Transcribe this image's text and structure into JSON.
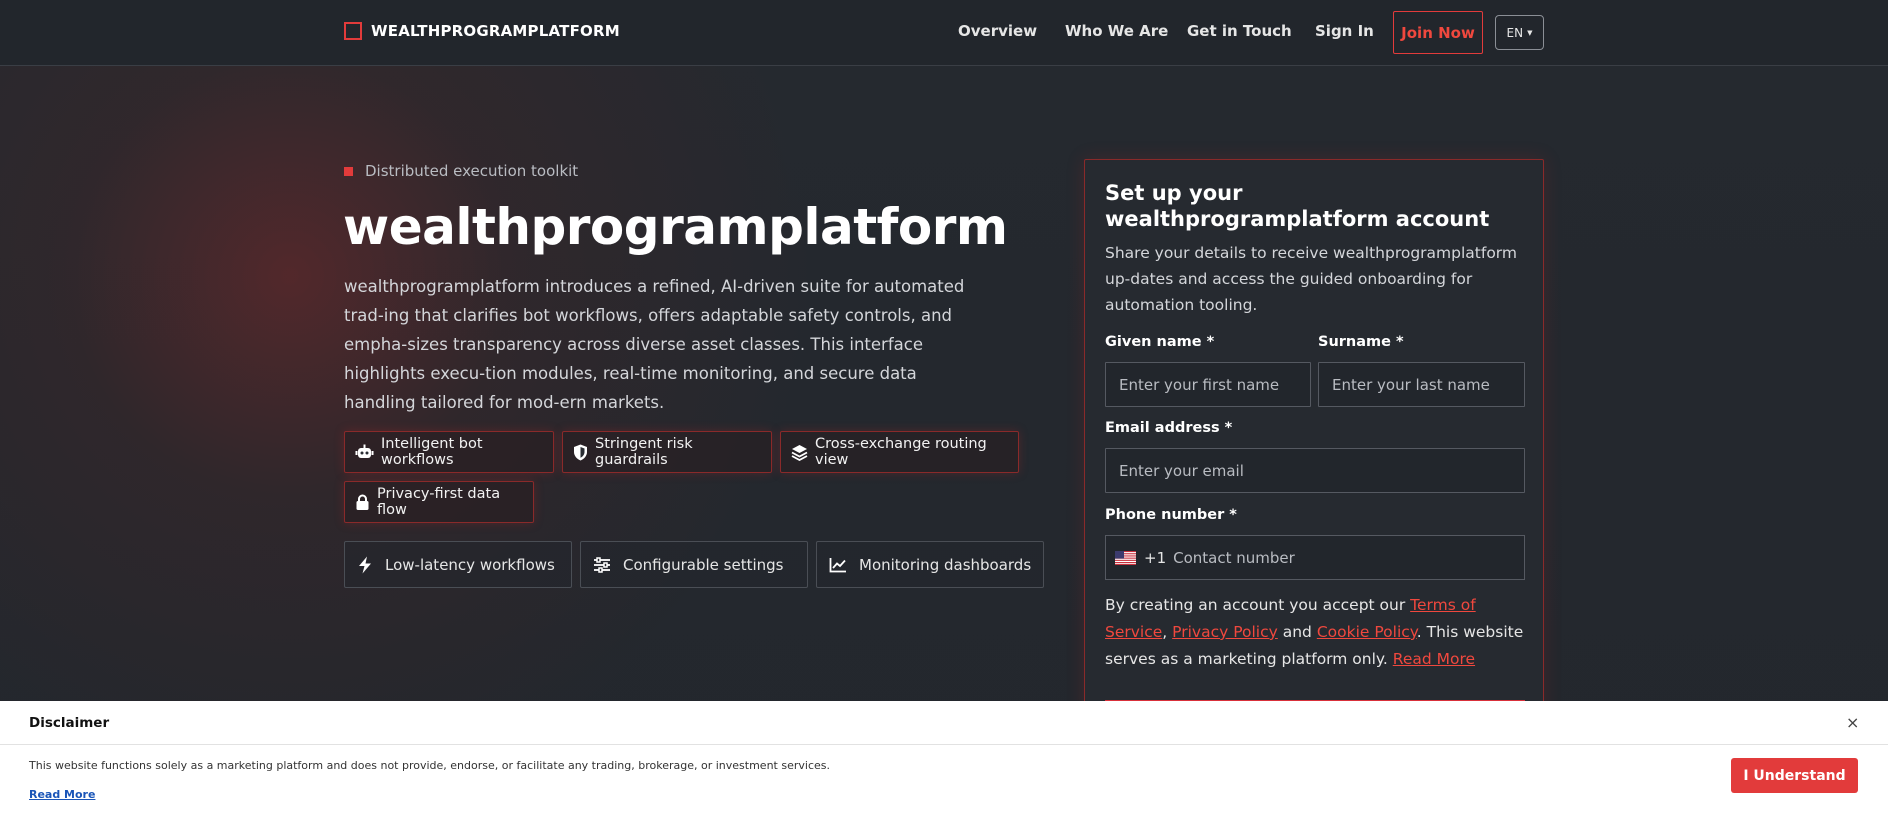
{
  "brand": {
    "name": "WEALTHPROGRAMPLATFORM",
    "accent": "#e23b3b"
  },
  "nav": {
    "overview": "Overview",
    "who_we_are": "Who We Are",
    "get_in_touch": "Get in Touch",
    "sign_in": "Sign In",
    "join_now": "Join Now",
    "language": "EN"
  },
  "hero": {
    "eyebrow": "Distributed execution toolkit",
    "title": "wealthprogramplatform",
    "description": "wealthprogramplatform introduces a refined, AI-driven suite for automated trad-ing that clarifies bot workflows, offers adaptable safety controls, and empha-sizes transparency across diverse asset classes. This interface highlights execu-tion modules, real-time monitoring, and secure data handling tailored for mod-ern markets.",
    "chips": [
      {
        "label": "Intelligent bot workflows",
        "icon": "robot-icon"
      },
      {
        "label": "Stringent risk guardrails",
        "icon": "shield-icon"
      },
      {
        "label": "Cross-exchange routing view",
        "icon": "layers-icon"
      },
      {
        "label": "Privacy-first data flow",
        "icon": "lock-icon"
      }
    ],
    "tiles": [
      {
        "label": "Low-latency workflows",
        "icon": "bolt-icon"
      },
      {
        "label": "Configurable settings",
        "icon": "sliders-icon"
      },
      {
        "label": "Monitoring dashboards",
        "icon": "chart-line-icon"
      }
    ]
  },
  "form": {
    "title": "Set up your wealthprogramplatform account",
    "description": "Share your details to receive wealthprogramplatform up-dates and access the guided onboarding for automation tooling.",
    "given_name_label": "Given name *",
    "given_name_placeholder": "Enter your first name",
    "surname_label": "Surname *",
    "surname_placeholder": "Enter your last name",
    "email_label": "Email address *",
    "email_placeholder": "Enter your email",
    "phone_label": "Phone number *",
    "phone_dial_code": "+1",
    "phone_placeholder": "Contact number",
    "legal_prefix": "By creating an account you accept our ",
    "terms_link": "Terms of Service",
    "comma": ",",
    "privacy_link": "Privacy Policy",
    "and": " and ",
    "cookie_link": "Cookie Policy",
    "legal_suffix": ". This website serves as a marketing platform only. ",
    "read_more_link": "Read More"
  },
  "disclaimer": {
    "title": "Disclaimer",
    "close": "×",
    "text": "This website functions solely as a marketing platform and does not provide, endorse, or facilitate any trading, brokerage, or investment services.",
    "read_more": "Read More",
    "button": "I Understand"
  }
}
